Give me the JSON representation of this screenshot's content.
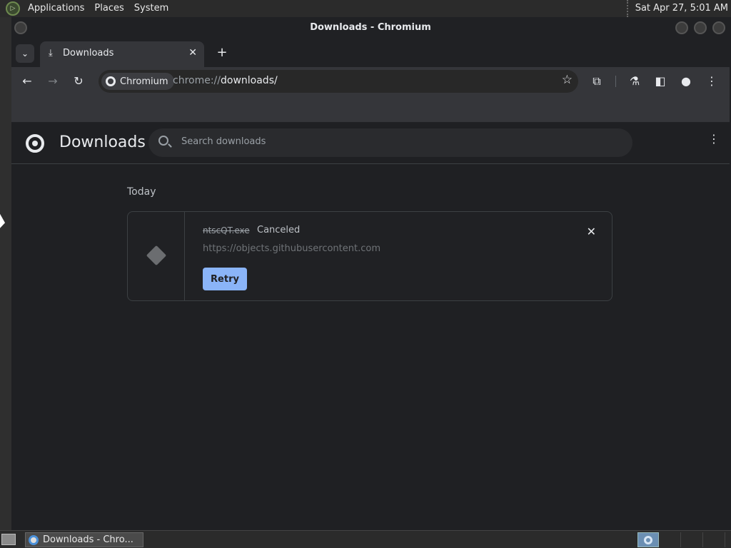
{
  "top_panel": {
    "menu": [
      "Applications",
      "Places",
      "System"
    ],
    "clock": "Sat Apr 27,  5:01 AM"
  },
  "window": {
    "title": "Downloads - Chromium"
  },
  "tabs": [
    {
      "label": "Downloads",
      "icon": "download-icon"
    }
  ],
  "toolbar": {
    "chip_label": "Chromium",
    "url_scheme": "chrome://",
    "url_host": "downloads/"
  },
  "downloads_page": {
    "title": "Downloads",
    "search_placeholder": "Search downloads",
    "section_date": "Today",
    "items": [
      {
        "file_name": "ntscQT.exe",
        "status": "Canceled",
        "url": "https://objects.githubusercontent.com",
        "action_label": "Retry"
      }
    ]
  },
  "taskbar": {
    "task_label": "Downloads - Chro..."
  },
  "colors": {
    "accent": "#8ab4f8",
    "background": "#1f2023",
    "toolbar": "#35363a"
  }
}
